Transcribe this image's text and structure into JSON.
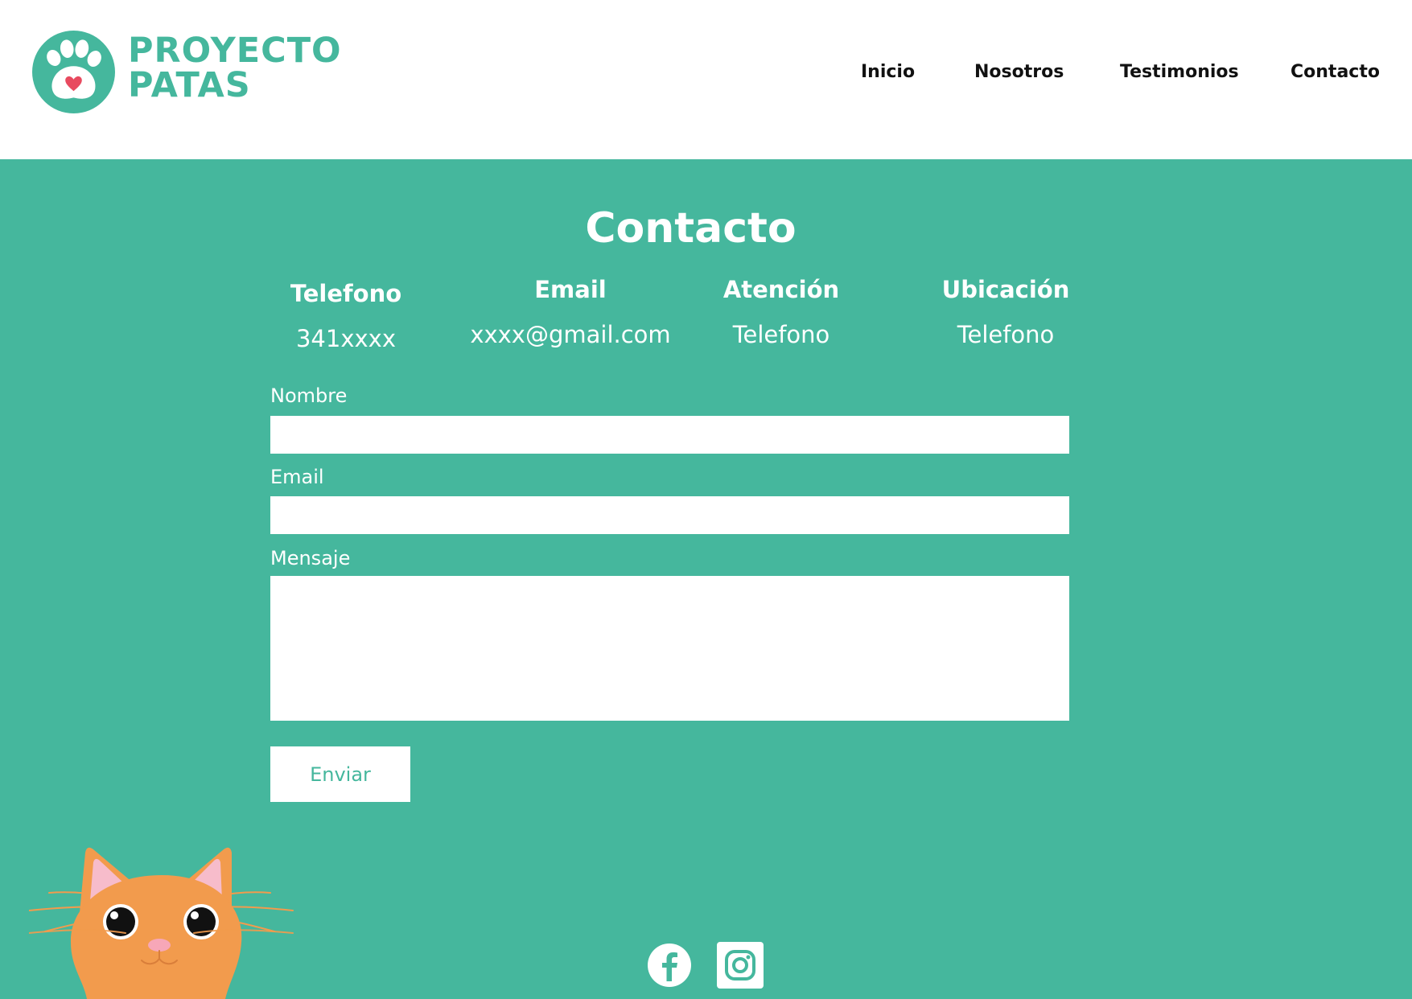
{
  "brand": {
    "name_line1": "PROYECTO",
    "name_line2": "PATAS",
    "color": "#45b79d",
    "accent": "#e84a5f",
    "icon": "paw-heart-icon"
  },
  "nav": {
    "items": [
      {
        "label": "Inicio"
      },
      {
        "label": "Nosotros"
      },
      {
        "label": "Testimonios"
      },
      {
        "label": "Contacto"
      }
    ]
  },
  "contact": {
    "title": "Contacto",
    "background": "#45b79d",
    "info": [
      {
        "heading": "Telefono",
        "value": "341xxxx"
      },
      {
        "heading": "Email",
        "value": "xxxx@gmail.com"
      },
      {
        "heading": "Atención",
        "value": "Telefono"
      },
      {
        "heading": "Ubicación",
        "value": "Telefono"
      }
    ],
    "form": {
      "name_label": "Nombre",
      "name_value": "",
      "email_label": "Email",
      "email_value": "",
      "message_label": "Mensaje",
      "message_value": "",
      "submit_label": "Enviar"
    }
  },
  "illustration": {
    "icon": "orange-cat-illustration",
    "fur_color": "#f29b4d",
    "ear_color": "#f7bccb"
  },
  "social": {
    "facebook_icon": "facebook-icon",
    "instagram_icon": "instagram-icon"
  }
}
